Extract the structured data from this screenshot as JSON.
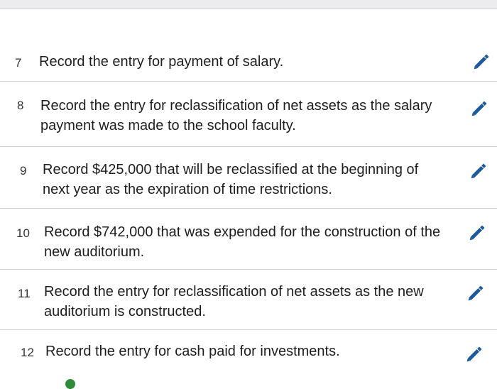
{
  "colors": {
    "pencil": "#1d5a9c",
    "divider": "#cfcfd3",
    "text": "#1e1e1e"
  },
  "rows": [
    {
      "num": "7",
      "text": "Record the entry for payment of salary.",
      "icon": "pencil-icon"
    },
    {
      "num": "8",
      "text": "Record the entry for reclassification of net assets as the salary payment was made to the school faculty.",
      "icon": "pencil-icon"
    },
    {
      "num": "9",
      "text": "Record $425,000 that will be reclassified at the beginning of next year as the expiration of time restrictions.",
      "icon": "pencil-icon"
    },
    {
      "num": "10",
      "text": "Record $742,000 that was expended for the construction of the new auditorium.",
      "icon": "pencil-icon"
    },
    {
      "num": "11",
      "text": "Record the entry for reclassification of net assets as the new auditorium is constructed.",
      "icon": "pencil-icon"
    },
    {
      "num": "12",
      "text": "Record the entry for cash paid for investments.",
      "icon": "pencil-icon"
    }
  ]
}
